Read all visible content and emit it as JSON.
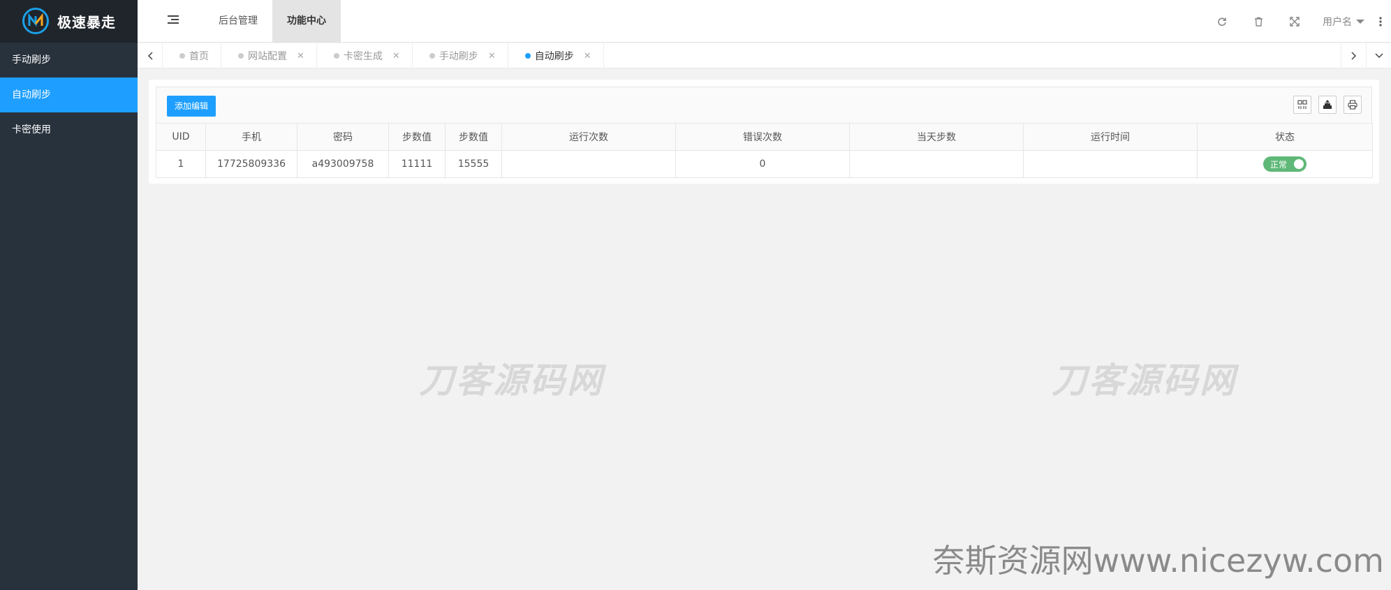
{
  "sidebar": {
    "logo_text": "极速暴走",
    "items": [
      {
        "label": "手动刷步"
      },
      {
        "label": "自动刷步"
      },
      {
        "label": "卡密使用"
      }
    ]
  },
  "header": {
    "nav": [
      {
        "label": "后台管理"
      },
      {
        "label": "功能中心"
      }
    ],
    "user_label": "用户名"
  },
  "tabs": [
    {
      "label": "首页",
      "closable": false
    },
    {
      "label": "网站配置",
      "closable": true
    },
    {
      "label": "卡密生成",
      "closable": true
    },
    {
      "label": "手动刷步",
      "closable": true
    },
    {
      "label": "自动刷步",
      "closable": true,
      "active": true
    }
  ],
  "toolbar": {
    "add_label": "添加编辑"
  },
  "table": {
    "columns": [
      "UID",
      "手机",
      "密码",
      "步数值",
      "步数值",
      "运行次数",
      "错误次数",
      "当天步数",
      "运行时间",
      "状态"
    ],
    "rows": [
      {
        "uid": "1",
        "phone": "17725809336",
        "password": "a493009758",
        "step_min": "11111",
        "step_max": "15555",
        "run_count": "",
        "error_count": "0",
        "today_steps": "",
        "run_time": "",
        "status": "正常"
      }
    ]
  },
  "watermarks": {
    "center": "刀客源码网",
    "bottom": "奈斯资源网www.nicezyw.com"
  },
  "colors": {
    "sidebar_bg": "#28323d",
    "accent": "#1e9fff",
    "switch_on": "#5fb878"
  }
}
